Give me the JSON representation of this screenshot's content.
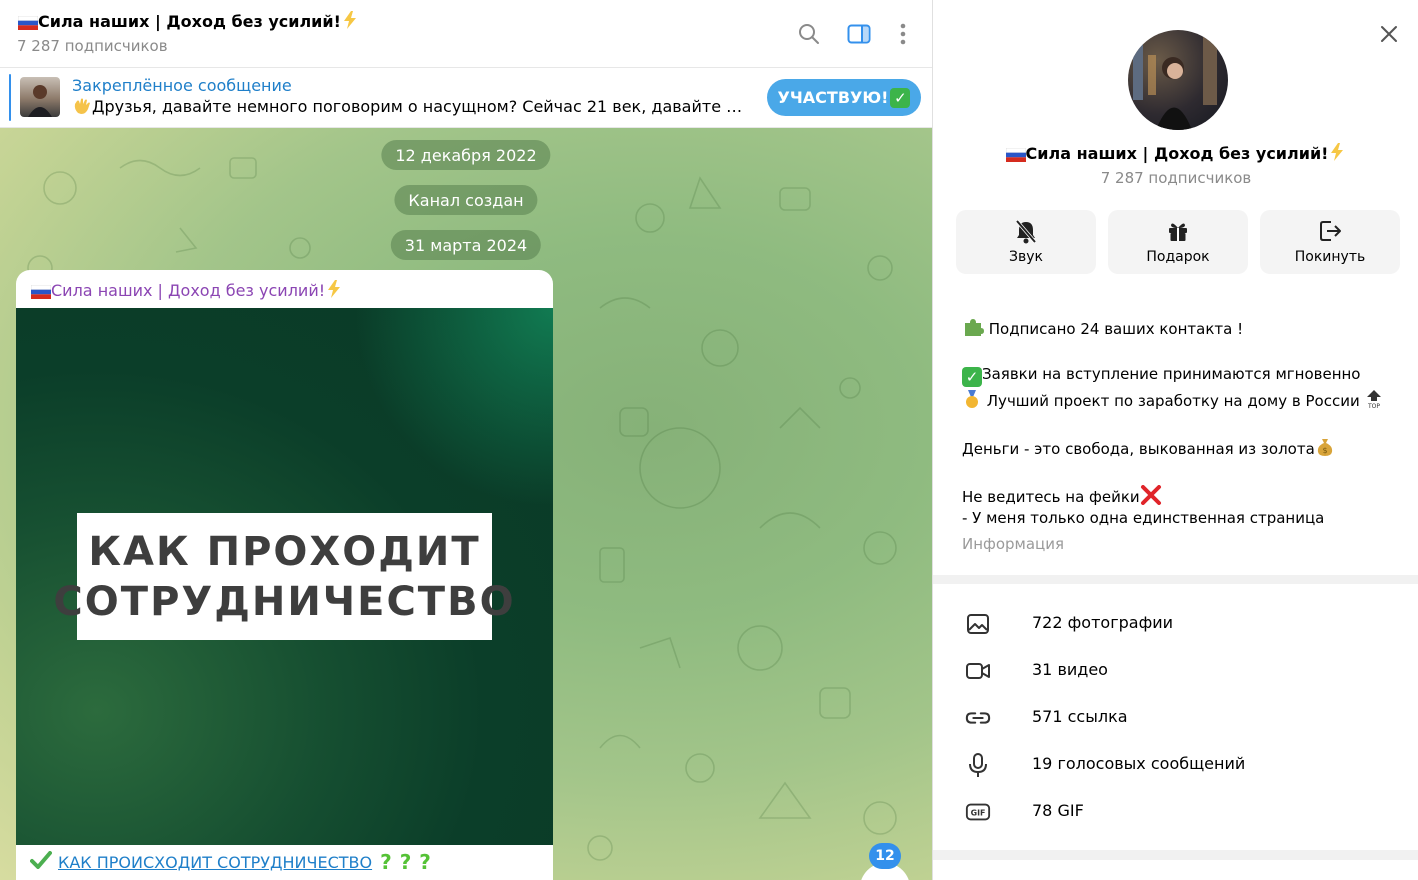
{
  "header": {
    "title": "Сила наших | Доход без усилий!",
    "subscribers": "7 287 подписчиков"
  },
  "pinned": {
    "title": "Закреплённое сообщение",
    "text": "Друзья, давайте немного поговорим о насущном? Сейчас 21 век, давайте рассуждать...",
    "button": "УЧАСТВУЮ!"
  },
  "chat": {
    "dates": [
      "12 декабря 2022",
      "Канал создан",
      "31 марта 2024"
    ],
    "post": {
      "author": "Сила наших | Доход без усилий!",
      "banner_line1": "КАК ПРОХОДИТ",
      "banner_line2": "СОТРУДНИЧЕСТВО",
      "link_text": "КАК ПРОИСХОДИТ СОТРУДНИЧЕСТВО",
      "q_marks": [
        "?",
        "?",
        "?"
      ]
    },
    "unread_count": "12"
  },
  "profile": {
    "name": "Сила наших | Доход без усилий!",
    "subscribers": "7 287 подписчиков",
    "actions": [
      {
        "label": "Звук",
        "icon": "bell-off-icon"
      },
      {
        "label": "Подарок",
        "icon": "gift-icon"
      },
      {
        "label": "Покинуть",
        "icon": "leave-icon"
      }
    ],
    "info": {
      "line1": "Подписано 24 ваших контакта !",
      "line2": "Заявки на вступление принимаются мгновенно",
      "line3": "Лучший проект по заработку на дому в России",
      "line4": "Деньги - это свобода, выкованная из золота",
      "line5": "Не ведитесь на фейки",
      "line6": "- У меня только одна единственная страница",
      "label": "Информация"
    },
    "media": [
      {
        "label": "722 фотографии",
        "icon": "photo-icon"
      },
      {
        "label": "31 видео",
        "icon": "video-icon"
      },
      {
        "label": "571 ссылка",
        "icon": "link-icon"
      },
      {
        "label": "19 голосовых сообщений",
        "icon": "microphone-icon"
      },
      {
        "label": "78 GIF",
        "icon": "gif-icon"
      }
    ]
  },
  "colors": {
    "accent": "#3390ec",
    "link": "#1f7fc9",
    "author": "#8b45b3",
    "join_button": "#4aa8e8"
  }
}
